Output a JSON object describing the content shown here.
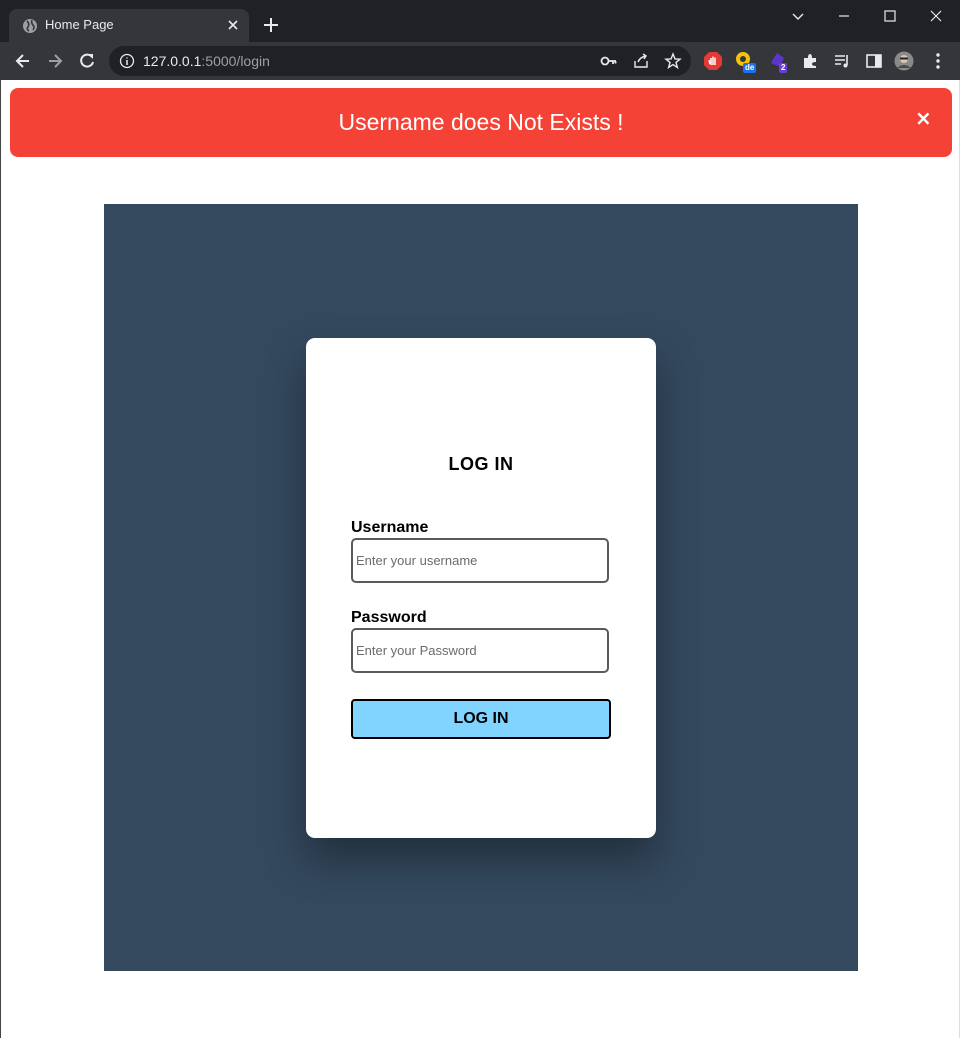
{
  "browser": {
    "tab_title": "Home Page",
    "url_host": "127.0.0.1",
    "url_rest": ":5000/login",
    "extension_badges": {
      "translate": "de",
      "counter": "2"
    }
  },
  "alert": {
    "message": "Username does Not Exists !",
    "close_glyph": "×",
    "color": "#f44336"
  },
  "login": {
    "title": "LOG IN",
    "username_label": "Username",
    "username_placeholder": "Enter your username",
    "username_value": "",
    "password_label": "Password",
    "password_placeholder": "Enter your Password",
    "password_value": "",
    "submit_label": "LOG IN",
    "panel_color": "#34495e",
    "button_color": "#80d4ff"
  }
}
